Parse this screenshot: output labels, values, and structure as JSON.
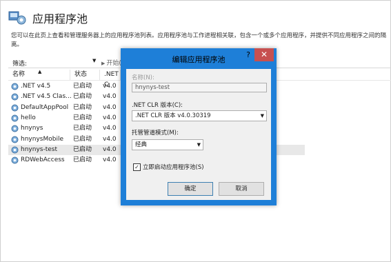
{
  "header": {
    "title": "应用程序池"
  },
  "description": "您可以在此页上查看和管理服务器上的应用程序池列表。应用程序池与工作进程相关联，包含一个或多个应用程序，并提供不同应用程序之间的隔离。",
  "filter": {
    "label": "筛选:",
    "value": "",
    "go_label": "开始(G)"
  },
  "table": {
    "columns": [
      "名称",
      "状态",
      ".NET C"
    ],
    "rows": [
      {
        "name": ".NET v4.5",
        "status": "已启动",
        "version": "v4.0"
      },
      {
        "name": ".NET v4.5 Clas...",
        "status": "已启动",
        "version": "v4.0"
      },
      {
        "name": "DefaultAppPool",
        "status": "已启动",
        "version": "v4.0"
      },
      {
        "name": "hello",
        "status": "已启动",
        "version": "v4.0"
      },
      {
        "name": "hnynys",
        "status": "已启动",
        "version": "v4.0"
      },
      {
        "name": "hnynysMobile",
        "status": "已启动",
        "version": "v4.0"
      },
      {
        "name": "hnynys-test",
        "status": "已启动",
        "version": "v4.0"
      },
      {
        "name": "RDWebAccess",
        "status": "已启动",
        "version": "v4.0"
      }
    ],
    "selected_index": 6
  },
  "dialog": {
    "title": "编辑应用程序池",
    "help_label": "?",
    "close_label": "✕",
    "name_label": "名称(N):",
    "name_value": "hnynys-test",
    "clr_label": ".NET CLR 版本(C):",
    "clr_value": ".NET CLR 版本 v4.0.30319",
    "pipeline_label": "托管管道模式(M):",
    "pipeline_value": "经典",
    "autostart_label": "立即启动应用程序池(S)",
    "autostart_checked": true,
    "ok_label": "确定",
    "cancel_label": "取消"
  },
  "colors": {
    "dialog_frame": "#1e7fd8",
    "close_button": "#c75050",
    "selected_row": "#e8e8e8"
  }
}
